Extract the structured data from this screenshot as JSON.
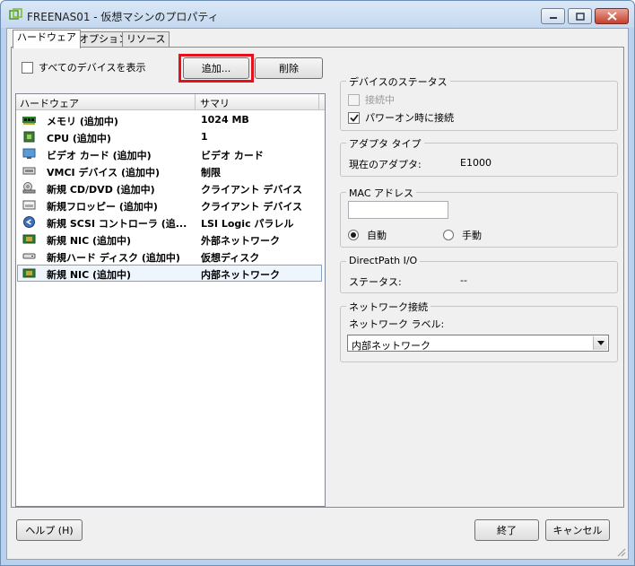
{
  "window": {
    "title": "FREENAS01 - 仮想マシンのプロパティ"
  },
  "tabs": [
    {
      "label": "ハードウェア",
      "active": true
    },
    {
      "label": "オプション",
      "active": false
    },
    {
      "label": "リソース",
      "active": false
    }
  ],
  "hardware": {
    "show_all_label": "すべてのデバイスを表示",
    "show_all_checked": false,
    "add_label": "追加...",
    "remove_label": "削除",
    "columns": [
      "ハードウェア",
      "サマリ"
    ],
    "rows": [
      {
        "name": "メモリ (追加中)",
        "summary": "1024 MB",
        "icon": "memory-icon"
      },
      {
        "name": "CPU (追加中)",
        "summary": "1",
        "icon": "cpu-icon"
      },
      {
        "name": "ビデオ カード (追加中)",
        "summary": "ビデオ カード",
        "icon": "monitor-icon"
      },
      {
        "name": "VMCI デバイス (追加中)",
        "summary": "制限",
        "icon": "vmci-device-icon"
      },
      {
        "name": "新規 CD/DVD (追加中)",
        "summary": "クライアント デバイス",
        "icon": "cd-dvd-icon"
      },
      {
        "name": "新規フロッピー (追加中)",
        "summary": "クライアント デバイス",
        "icon": "floppy-icon"
      },
      {
        "name": "新規 SCSI コントローラ (追...",
        "summary": "LSI Logic パラレル",
        "icon": "scsi-controller-icon"
      },
      {
        "name": "新規 NIC (追加中)",
        "summary": "外部ネットワーク",
        "icon": "nic-icon"
      },
      {
        "name": "新規ハード ディスク (追加中)",
        "summary": "仮想ディスク",
        "icon": "hard-disk-icon"
      },
      {
        "name": "新規 NIC (追加中)",
        "summary": "内部ネットワーク",
        "icon": "nic-icon",
        "selected": true
      }
    ]
  },
  "device_status": {
    "title": "デバイスのステータス",
    "connected_label": "接続中",
    "connected_checked": false,
    "connect_at_power_on_label": "パワーオン時に接続",
    "connect_at_power_on_checked": true
  },
  "adapter_type": {
    "title": "アダプタ タイプ",
    "current_label": "現在のアダプタ:",
    "current_value": "E1000"
  },
  "mac_address": {
    "title": "MAC アドレス",
    "value": "",
    "auto_label": "自動",
    "manual_label": "手動",
    "selected": "auto"
  },
  "directpath": {
    "title": "DirectPath I/O",
    "status_label": "ステータス:",
    "status_value": "--"
  },
  "network_connection": {
    "title": "ネットワーク接続",
    "label_caption": "ネットワーク ラベル:",
    "selected_network": "内部ネットワーク"
  },
  "footer": {
    "help_label": "ヘルプ (H)",
    "finish_label": "終了",
    "cancel_label": "キャンセル"
  }
}
